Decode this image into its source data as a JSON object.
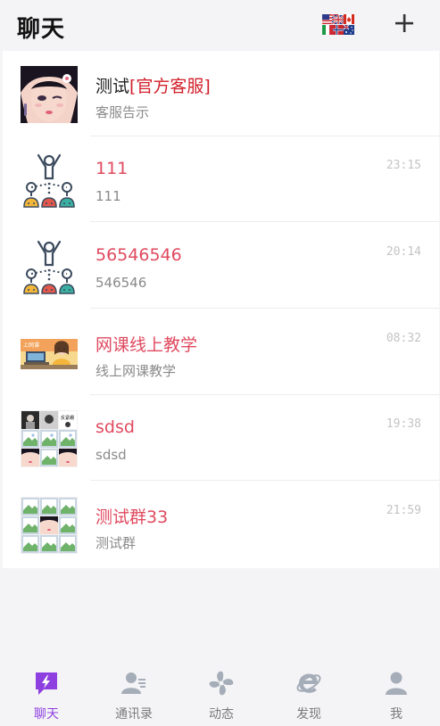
{
  "header": {
    "title": "聊天",
    "flags_icon": "language-flags-icon",
    "add_icon": "plus-icon"
  },
  "chats": [
    {
      "name_main": "测试",
      "name_tag": "[官方客服]",
      "preview": "客服告示",
      "time": "",
      "avatar": "anime-girl-avatar"
    },
    {
      "name": "111",
      "preview": "111",
      "time": "23:15",
      "avatar": "group-people-icon"
    },
    {
      "name": "56546546",
      "preview": "546546",
      "time": "20:14",
      "avatar": "group-people-icon"
    },
    {
      "name": "网课线上教学",
      "preview": "线上网课教学",
      "time": "08:32",
      "avatar": "online-class-avatar",
      "avatar_text": "上网课"
    },
    {
      "name": "sdsd",
      "preview": "sdsd",
      "time": "19:38",
      "avatar": "group-grid-avatar",
      "avatar_text": "反紧绷"
    },
    {
      "name": "测试群33",
      "preview": "测试群",
      "time": "21:59",
      "avatar": "group-grid-avatar"
    }
  ],
  "tabs": [
    {
      "label": "聊天",
      "icon": "chat-bolt-icon",
      "active": true
    },
    {
      "label": "通讯录",
      "icon": "contacts-icon",
      "active": false
    },
    {
      "label": "动态",
      "icon": "fan-icon",
      "active": false
    },
    {
      "label": "发现",
      "icon": "explorer-icon",
      "active": false
    },
    {
      "label": "我",
      "icon": "person-icon",
      "active": false
    }
  ],
  "colors": {
    "accent": "#8e3fe0",
    "name_red": "#e04a5f",
    "official_tag": "#d21f2a",
    "tab_inactive": "#a5adb8"
  }
}
